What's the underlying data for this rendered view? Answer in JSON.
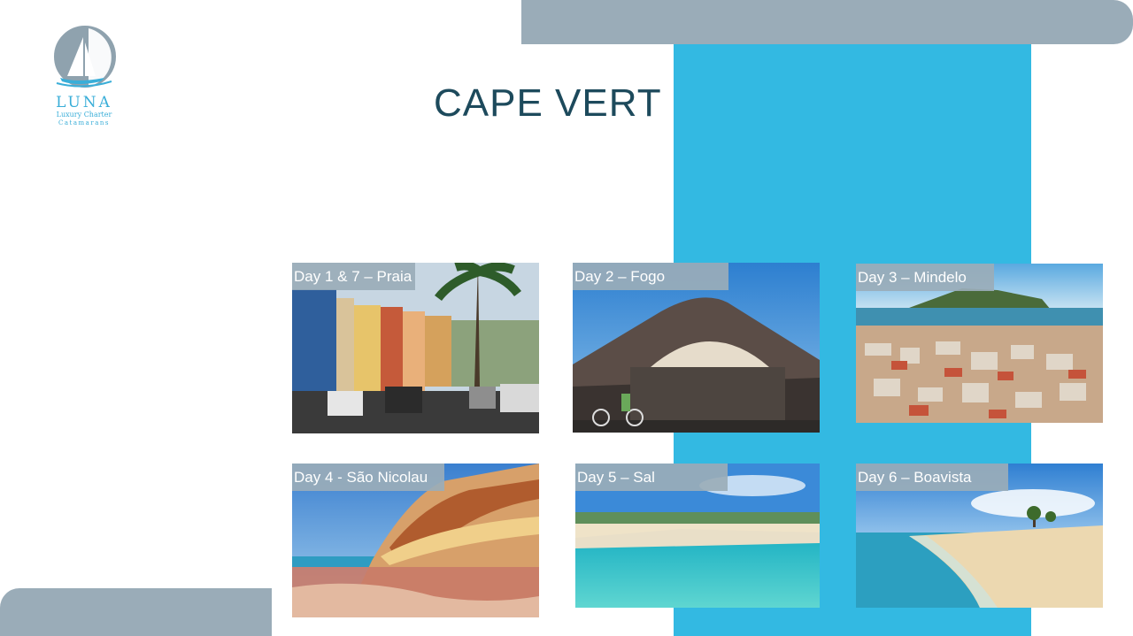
{
  "logo": {
    "brand": "LUNA",
    "line1": "Luxury Charter",
    "line2": "Catamarans"
  },
  "title": "CAPE VERT",
  "days": [
    {
      "label": "Day 1 & 7 – Praia"
    },
    {
      "label": "Day 2 – Fogo"
    },
    {
      "label": "Day 3 – Mindelo"
    },
    {
      "label": "Day 4 - São Nicolau"
    },
    {
      "label": "Day 5 – Sal"
    },
    {
      "label": "Day 6 – Boavista"
    }
  ]
}
